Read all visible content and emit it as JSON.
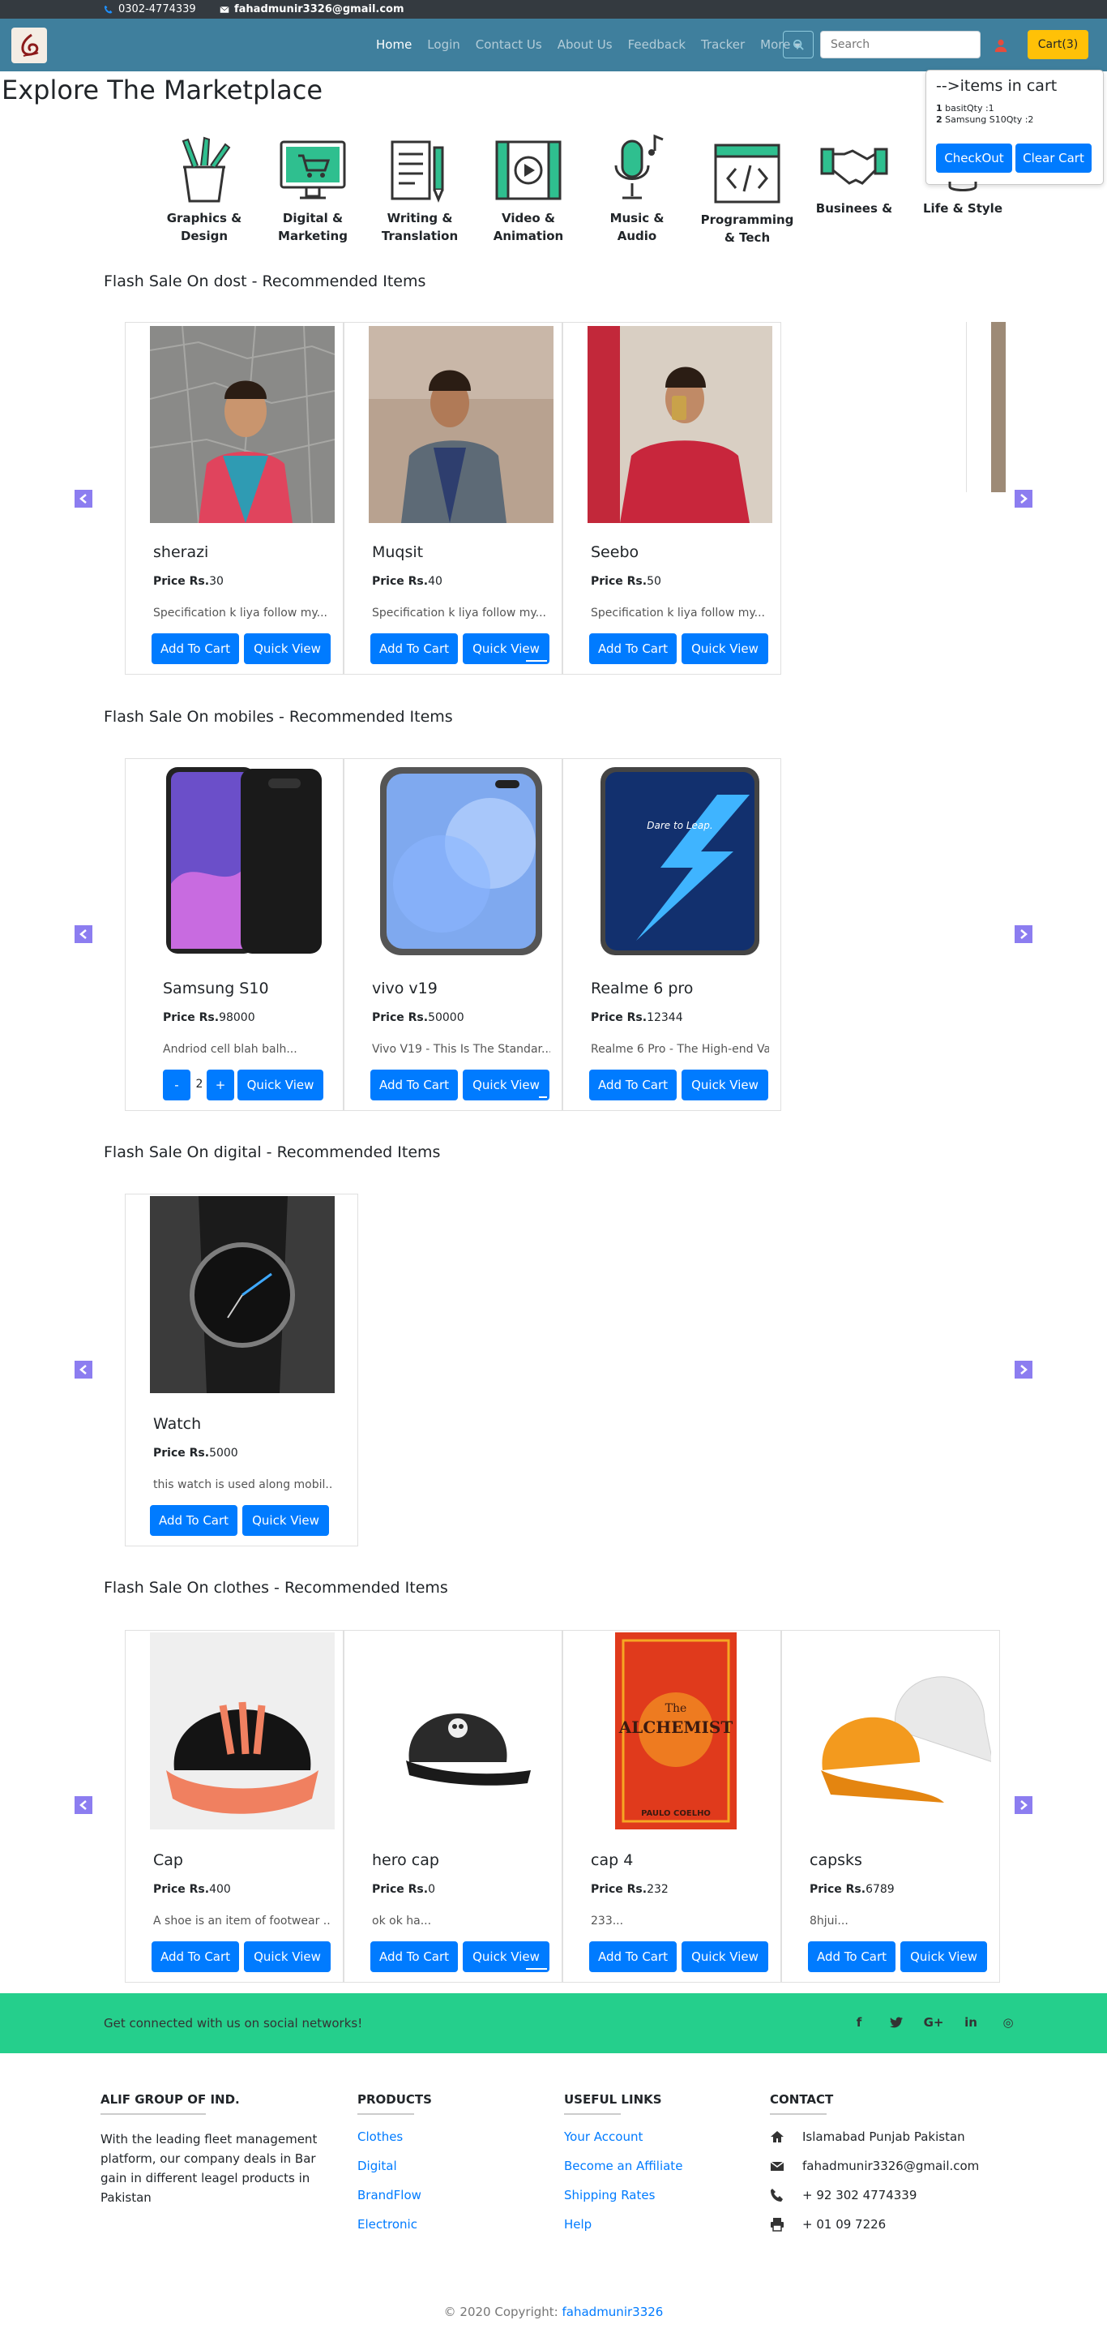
{
  "topbar": {
    "phone": "0302-4774339",
    "email": "fahadmunir3326@gmail.com"
  },
  "nav": {
    "links": [
      "Home",
      "Login",
      "Contact Us",
      "About Us",
      "Feedback",
      "Tracker",
      "More"
    ],
    "search_placeholder": "Search",
    "cart_label": "Cart(3)"
  },
  "cart_popover": {
    "title": "-->items in cart",
    "items": [
      {
        "num": "1",
        "text": "basitQty :1"
      },
      {
        "num": "2",
        "text": "Samsung S10Qty :2"
      }
    ],
    "checkout": "CheckOut",
    "clear": "Clear Cart"
  },
  "heading": "Explore The Marketplace",
  "categories": [
    {
      "icon": "pencil-cup-icon",
      "label_1": "Graphics &",
      "label_2": "Design"
    },
    {
      "icon": "monitor-cart-icon",
      "label_1": "Digital &",
      "label_2": "Marketing"
    },
    {
      "icon": "document-pen-icon",
      "label_1": "Writing &",
      "label_2": "Translation"
    },
    {
      "icon": "film-play-icon",
      "label_1": "Video &",
      "label_2": "Animation"
    },
    {
      "icon": "microphone-note-icon",
      "label_1": "Music &",
      "label_2": "Audio"
    },
    {
      "icon": "code-window-icon",
      "label_1": "Programming",
      "label_2": "& Tech"
    },
    {
      "icon": "handshake-icon",
      "label_1": "Businees",
      "label_2": ""
    },
    {
      "icon": "lifestyle-icon",
      "label_1": "Life & Style",
      "label_2": ""
    }
  ],
  "sections": [
    {
      "title": "Flash Sale On dost - Recommended Items",
      "products": [
        {
          "name": "sherazi",
          "price_label": "Price Rs.",
          "price": "30",
          "desc": "Specification k liya follow my...",
          "add": "Add To Cart",
          "quick": "Quick View"
        },
        {
          "name": "Muqsit",
          "price_label": "Price Rs.",
          "price": "40",
          "desc": "Specification k liya follow my...",
          "add": "Add To Cart",
          "quick": "Quick View"
        },
        {
          "name": "Seebo",
          "price_label": "Price Rs.",
          "price": "50",
          "desc": "Specification k liya follow my...",
          "add": "Add To Cart",
          "quick": "Quick View"
        }
      ]
    },
    {
      "title": "Flash Sale On mobiles - Recommended Items",
      "products": [
        {
          "name": "Samsung S10",
          "price_label": "Price Rs.",
          "price": "98000",
          "desc": "Andriod cell blah balh...",
          "minus": "-",
          "qty": "2",
          "plus": "+",
          "quick": "Quick View"
        },
        {
          "name": "vivo v19",
          "price_label": "Price Rs.",
          "price": "50000",
          "desc": "Vivo V19 - This Is The Standar...",
          "add": "Add To Cart",
          "quick": "Quick View"
        },
        {
          "name": "Realme 6 pro",
          "price_label": "Price Rs.",
          "price": "12344",
          "desc": "Realme 6 Pro - The High-end Va...",
          "add": "Add To Cart",
          "quick": "Quick View",
          "screen_text": "Dare to Leap."
        }
      ]
    },
    {
      "title": "Flash Sale On digital - Recommended Items",
      "products": [
        {
          "name": "Watch",
          "price_label": "Price Rs.",
          "price": "5000",
          "desc": "this watch is used along mobil...",
          "add": "Add To Cart",
          "quick": "Quick View"
        }
      ]
    },
    {
      "title": "Flash Sale On clothes - Recommended Items",
      "products": [
        {
          "name": "Cap",
          "price_label": "Price Rs.",
          "price": "400",
          "desc": "A shoe is an item of footwear ...",
          "add": "Add To Cart",
          "quick": "Quick View"
        },
        {
          "name": "hero cap",
          "price_label": "Price Rs.",
          "price": "0",
          "desc": "ok ok ha...",
          "add": "Add To Cart",
          "quick": "Quick View"
        },
        {
          "name": "cap 4",
          "price_label": "Price Rs.",
          "price": "232",
          "desc": "233...",
          "add": "Add To Cart",
          "quick": "Quick View",
          "book_title_1": "The",
          "book_title_2": "ALCHEMIST",
          "book_author": "PAULO COELHO"
        },
        {
          "name": "capsks",
          "price_label": "Price Rs.",
          "price": "6789",
          "desc": "8hjui...",
          "add": "Add To Cart",
          "quick": "Quick View"
        }
      ]
    }
  ],
  "footer": {
    "social_text": "Get connected with us on social networks!",
    "social_icons": [
      "f",
      "t",
      "G+",
      "in",
      "◎"
    ],
    "about_title": "ALIF GROUP OF IND.",
    "about_text": "With the leading fleet management platform, our company deals in Bar gain in different leagel products in Pakistan",
    "products_title": "PRODUCTS",
    "products": [
      "Clothes",
      "Digital",
      "BrandFlow",
      "Electronic"
    ],
    "links_title": "USEFUL LINKS",
    "links": [
      "Your Account",
      "Become an Affiliate",
      "Shipping Rates",
      "Help"
    ],
    "contact_title": "CONTACT",
    "contact": [
      {
        "icon": "home-icon",
        "text": "Islamabad Punjab Pakistan"
      },
      {
        "icon": "envelope-icon",
        "text": "fahadmunir3326@gmail.com"
      },
      {
        "icon": "phone-icon",
        "text": "+ 92 302 4774339"
      },
      {
        "icon": "print-icon",
        "text": "+ 01 09 7226"
      }
    ],
    "copyright_prefix": "© 2020 Copyright:",
    "copyright_link": "fahadmunir3326"
  }
}
